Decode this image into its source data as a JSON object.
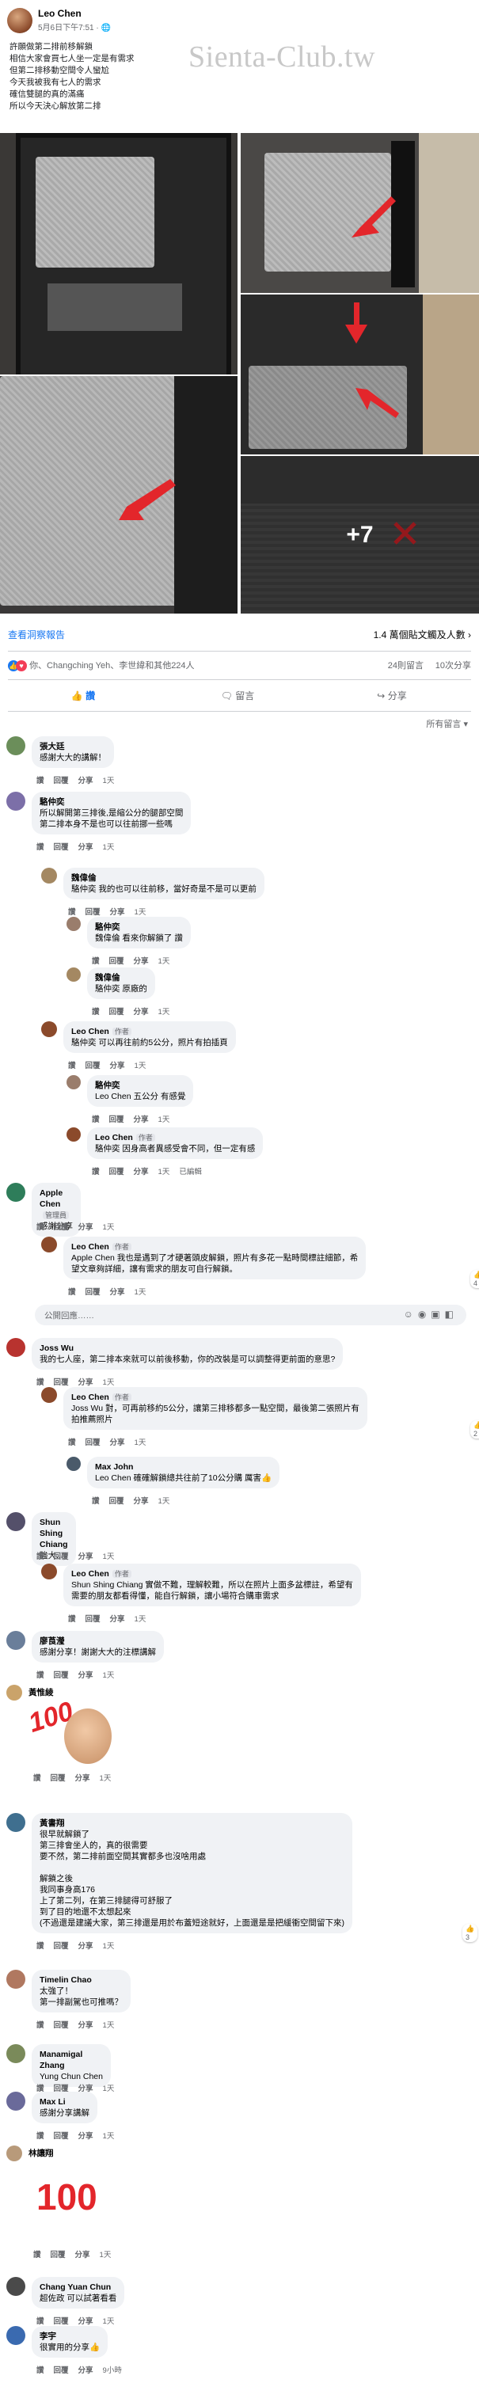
{
  "post": {
    "author": "Leo Chen",
    "time": "5月6日下午7:51 · ",
    "watermark": "Sienta-Club.tw",
    "lines": [
      "許願做第二排前移解鎖",
      "相信大家會買七人坐一定是有需求",
      "但第二排移動空間令人蠻尬",
      "今天我被我有七人的需求",
      "確信雙腿的真的滿痛",
      "所以今天決心解放第二排"
    ],
    "more_photos": "+7",
    "insights": "查看洞察報告",
    "reach": "1.4 萬個貼文觸及人數",
    "reactions": "你、Changching Yeh、李世緯和其他224人",
    "comments_count": "24則留言",
    "shares_count": "10次分享",
    "actions": {
      "like": "讚",
      "comment": "留言",
      "share": "分享"
    },
    "sort": "所有留言"
  },
  "meta_labels": {
    "like": "讚",
    "reply": "回覆",
    "share": "分享"
  },
  "compose_placeholder": "公開回應……",
  "comments": [
    {
      "name": "張大廷",
      "lines": [
        "感謝大大的講解！"
      ],
      "time": "1天"
    },
    {
      "name": "駱仲奕",
      "lines": [
        "所以解開第三排後,是縮公分的腿部空間",
        "第二排本身不是也可以往前挪一些嗎"
      ],
      "time": "1天"
    },
    {
      "name": "魏偉倫",
      "lines": [
        "駱仲奕 我的也可以往前移，當好奇是不是可以更前"
      ],
      "time": "1天"
    },
    {
      "name": "駱仲奕",
      "lines": [
        "魏偉倫 看來你解鎖了 讚"
      ],
      "time": "1天"
    },
    {
      "name": "魏偉倫",
      "lines": [
        "駱仲奕 原廠的"
      ],
      "time": "1天"
    },
    {
      "name": "Leo Chen",
      "tag": "作者",
      "lines": [
        "駱仲奕 可以再往前約5公分，照片有拍插頁"
      ],
      "time": "1天"
    },
    {
      "name": "駱仲奕",
      "lines": [
        "Leo Chen 五公分 有感覺"
      ],
      "time": "1天"
    },
    {
      "name": "Leo Chen",
      "tag": "作者",
      "lines": [
        "駱仲奕 因身高者異感受會不同，但一定有感"
      ],
      "time": "1天",
      "edited": "已編輯"
    },
    {
      "name": "Apple Chen",
      "tag": "管理員",
      "lines": [
        "感謝分享"
      ],
      "time": "1天"
    },
    {
      "name": "Leo Chen",
      "tag": "作者",
      "lines": [
        "Apple Chen 我也是遇到了才硬著頭皮解鎖，照片有多花一點時間標註細節，希",
        "望文章夠詳細，讓有需求的朋友可自行解鎖。"
      ],
      "time": "1天",
      "reaction_count": "4"
    },
    {
      "name": "Joss Wu",
      "lines": [
        "我的七人座，第二排本來就可以前後移動，你的改裝是可以調整得更前面的意思?"
      ],
      "time": "1天"
    },
    {
      "name": "Leo Chen",
      "tag": "作者",
      "lines": [
        "Joss Wu 對，可再前移約5公分，讓第三排移都多一點空間，最後第二張照片有",
        "拍推薦照片"
      ],
      "time": "1天",
      "reaction_count": "2"
    },
    {
      "name": "Max John",
      "lines": [
        "Leo Chen 確確解鎖總共往前了10公分購 厲害👍"
      ],
      "time": "1天"
    },
    {
      "name": "Shun Shing Chiang",
      "lines": [
        "強大...."
      ],
      "time": "1天"
    },
    {
      "name": "Leo Chen",
      "tag": "作者",
      "lines": [
        "Shun Shing Chiang 實做不難，理解較難，所以在照片上面多盆標註，希望有",
        "需要的朋友都看得懂，能自行解鎖，讓小場符合購車需求"
      ],
      "time": "1天"
    },
    {
      "name": "廖莨瀅",
      "lines": [
        "感謝分享！謝謝大大的注標講解"
      ],
      "time": "1天"
    },
    {
      "name": "黃惟綾",
      "lines": [],
      "time": "1天"
    },
    {
      "name": "黃書翔",
      "lines": [
        "很早就解鎖了",
        "第三排會坐人的，真的很需要",
        "要不然，第二排前面空間其實都多也沒啥用處",
        "",
        "解鎖之後",
        "我同事身高176",
        "上了第二列，在第三排腿得可舒服了",
        "到了目的地還不太想起來",
        "(不過還是建議大家，第三排還是用於布蓋短途就好，上面還是是把緩衝空間留下來)"
      ],
      "time": "1天",
      "reaction_count": "3"
    },
    {
      "name": "Timelin Chao",
      "lines": [
        "太強了！",
        "第一排副駕也可推嗎？"
      ],
      "time": "1天"
    },
    {
      "name": "Manamigal Zhang",
      "lines": [
        "Yung Chun Chen"
      ],
      "time": "1天"
    },
    {
      "name": "Max Li",
      "lines": [
        "感謝分享講解"
      ],
      "time": "1天"
    },
    {
      "name": "林讓翔",
      "lines": [],
      "time": "1天"
    },
    {
      "name": "Chang Yuan Chun",
      "lines": [
        "超佐政 可以試著看看"
      ],
      "time": "1天"
    },
    {
      "name": "李宇",
      "lines": [
        "很實用的分享👍"
      ],
      "time": "9小時"
    }
  ],
  "stickers": {
    "hundred": "100"
  },
  "colors": {
    "link": "#1877f2",
    "bubble": "#f0f2f5",
    "red": "#e3262b",
    "muted": "#65676b"
  }
}
